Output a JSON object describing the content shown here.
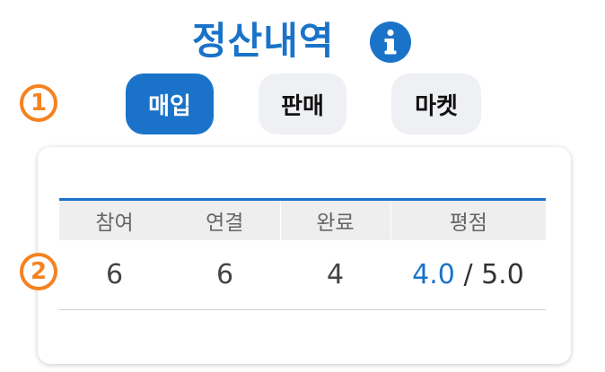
{
  "header": {
    "title": "정산내역",
    "info_icon": "info-icon",
    "accent_color": "#1a73c8"
  },
  "step_badges": [
    {
      "label": "1",
      "color": "#f58220"
    },
    {
      "label": "2",
      "color": "#f58220"
    }
  ],
  "tabs": [
    {
      "label": "매입",
      "active": true
    },
    {
      "label": "판매",
      "active": false
    },
    {
      "label": "마켓",
      "active": false
    }
  ],
  "stats": {
    "columns": [
      "참여",
      "연결",
      "완료",
      "평점"
    ],
    "values": {
      "participation": "6",
      "connection": "6",
      "completion": "4",
      "rating": "4.0",
      "rating_separator": "/",
      "rating_max": "5.0"
    }
  }
}
